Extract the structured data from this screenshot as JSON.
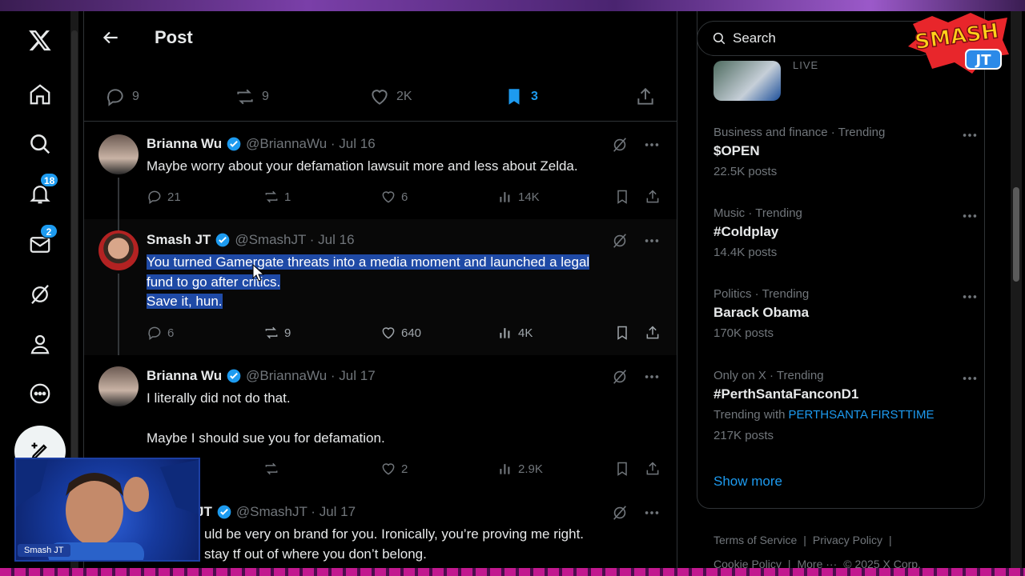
{
  "header": {
    "title": "Post"
  },
  "nav": {
    "notifications_count": "18",
    "messages_count": "2"
  },
  "action_bar": {
    "replies": "9",
    "reposts": "9",
    "likes": "2K",
    "bookmarks": "3"
  },
  "tweets": [
    {
      "name": "Brianna Wu",
      "handle": "@BriannaWu · Jul 16",
      "text": "Maybe worry about your defamation lawsuit more and less about Zelda.",
      "replies": "21",
      "reposts": "1",
      "likes": "6",
      "views": "14K"
    },
    {
      "name": "Smash JT",
      "handle": "@SmashJT · Jul 16",
      "line1": "You turned Gamergate threats into a media moment and launched a legal",
      "line2": "fund to go after critics.",
      "line3": "Save it, hun.",
      "replies": "6",
      "reposts": "9",
      "likes": "640",
      "views": "4K"
    },
    {
      "name": "Brianna Wu",
      "handle": "@BriannaWu · Jul 17",
      "line1": "I literally did not do that.",
      "line2": "Maybe I should sue you for defamation.",
      "likes": "2",
      "views": "2.9K"
    },
    {
      "name_partial": "JT",
      "handle": "@SmashJT · Jul 17",
      "line1": "uld be very on brand for you. Ironically, you’re proving me right.",
      "line2": "stay tf out of where you don’t belong."
    }
  ],
  "sidebar": {
    "search_placeholder": "Search",
    "live_label": "LIVE",
    "logo_text_1": "SMASH",
    "logo_text_2": "JT",
    "trends": [
      {
        "meta": "Business and finance · Trending",
        "name": "$OPEN",
        "count": "22.5K posts"
      },
      {
        "meta": "Music · Trending",
        "name": "#Coldplay",
        "count": "14.4K posts"
      },
      {
        "meta": "Politics · Trending",
        "name": "Barack Obama",
        "count": "170K posts"
      },
      {
        "meta": "Only on X · Trending",
        "name": "#PerthSantaFanconD1",
        "with_label": "Trending with",
        "with_links": "PERTHSANTA FIRSTTIME",
        "count": "217K posts"
      }
    ],
    "show_more": "Show more",
    "footer": {
      "terms": "Terms of Service",
      "sep1": "|",
      "privacy": "Privacy Policy",
      "sep2": "|",
      "cookie": "Cookie Policy",
      "sep3": "|",
      "more": "More ···",
      "copyright": "© 2025 X Corp."
    }
  },
  "webcam": {
    "label": "Smash JT"
  },
  "colors": {
    "accent": "#1d9bf0",
    "selection": "#1f4aa6",
    "muted": "#71767b",
    "border": "#2f3336"
  }
}
